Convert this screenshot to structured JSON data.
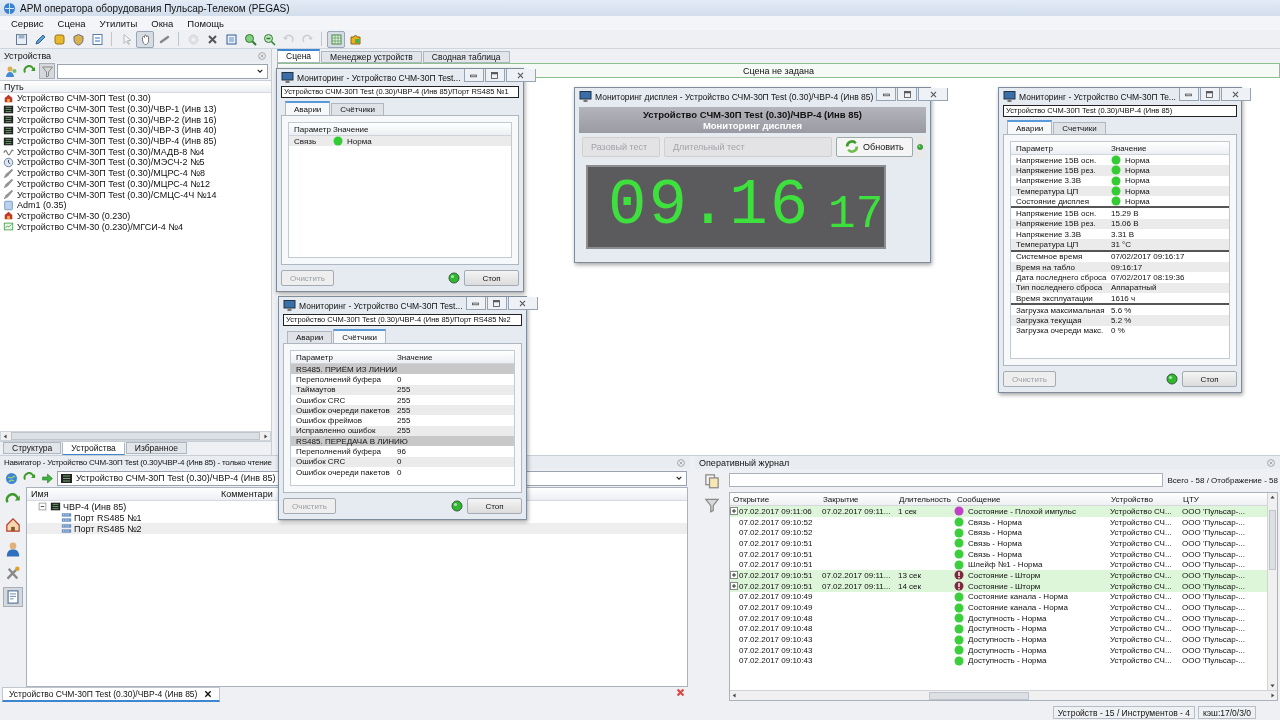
{
  "window": {
    "title": "АРМ оператора оборудования Пульсар-Телеком (PEGAS)"
  },
  "menu": [
    "Сервис",
    "Сцена",
    "Утилиты",
    "Окна",
    "Помощь"
  ],
  "toolbar": [
    {
      "pressed": false,
      "disabled": false
    },
    {
      "pressed": false,
      "disabled": false
    },
    {
      "pressed": false,
      "disabled": false
    },
    {
      "pressed": false,
      "disabled": false
    },
    {
      "pressed": false,
      "disabled": false
    },
    {
      "pressed": false,
      "disabled": true
    },
    {
      "pressed": true,
      "disabled": false
    },
    {
      "pressed": false,
      "disabled": false
    },
    {
      "pressed": false,
      "disabled": true
    },
    {
      "pressed": false,
      "disabled": false
    },
    {
      "pressed": false,
      "disabled": false
    },
    {
      "pressed": false,
      "disabled": false
    },
    {
      "pressed": false,
      "disabled": false
    },
    {
      "pressed": false,
      "disabled": true
    },
    {
      "pressed": false,
      "disabled": true
    },
    {
      "pressed": true,
      "disabled": false
    },
    {
      "pressed": false,
      "disabled": false
    }
  ],
  "devices_panel": {
    "title": "Устройства",
    "column": "Путь",
    "items": [
      {
        "label": "Устройство СЧМ-30П Test (0.30)",
        "kind": "alarm"
      },
      {
        "label": "Устройство СЧМ-30П Test (0.30)/ЧВР-1 (Инв 13)",
        "kind": "board"
      },
      {
        "label": "Устройство СЧМ-30П Test (0.30)/ЧВР-2 (Инв 16)",
        "kind": "board"
      },
      {
        "label": "Устройство СЧМ-30П Test (0.30)/ЧВР-3 (Инв 40)",
        "kind": "board"
      },
      {
        "label": "Устройство СЧМ-30П Test (0.30)/ЧВР-4 (Инв 85)",
        "kind": "board"
      },
      {
        "label": "Устройство СЧМ-30П Test (0.30)/МАДВ-8 №4",
        "kind": "wave"
      },
      {
        "label": "Устройство СЧМ-30П Test (0.30)/МЭСЧ-2 №5",
        "kind": "clock"
      },
      {
        "label": "Устройство СЧМ-30П Test (0.30)/МЦРС-4 №8",
        "kind": "pen"
      },
      {
        "label": "Устройство СЧМ-30П Test (0.30)/МЦРС-4 №12",
        "kind": "pen"
      },
      {
        "label": "Устройство СЧМ-30П Test (0.30)/СМЦС-4Ч №14",
        "kind": "pen"
      },
      {
        "label": "Adm1 (0.35)",
        "kind": "panel"
      },
      {
        "label": "Устройство СЧМ-30 (0.230)",
        "kind": "alarm"
      },
      {
        "label": "Устройство СЧМ-30 (0.230)/МГСИ-4 №4",
        "kind": "chart"
      }
    ],
    "tabs": [
      {
        "label": "Структура",
        "selected": false
      },
      {
        "label": "Устройства",
        "selected": true
      },
      {
        "label": "Избранное",
        "selected": false
      }
    ]
  },
  "scene_tabs": [
    {
      "label": "Сцена",
      "selected": true
    },
    {
      "label": "Менеджер устройств",
      "selected": false
    },
    {
      "label": "Сводная таблица",
      "selected": false
    }
  ],
  "scene_title": "Сцена не задана",
  "monitors": [
    {
      "title": "Мониторинг - Устройство СЧМ-30П Test...",
      "path": "Устройство СЧМ-30П Test (0.30)/ЧВР-4 (Инв 85)/Порт RS485 №1",
      "tabs": [
        {
          "label": "Аварии",
          "selected": true
        },
        {
          "label": "Счётчики",
          "selected": false
        }
      ],
      "columns": [
        "Параметр",
        "Значение"
      ],
      "groups": [
        [
          {
            "kind": "status",
            "name": "Связь",
            "value": "Норма",
            "color": "#33cc33"
          }
        ]
      ],
      "clear_button": {
        "label": "Очистить",
        "disabled": true
      },
      "running": true,
      "stop_button": "Стоп"
    },
    {
      "title": "Мониторинг - Устройство СЧМ-30П Test...",
      "path": "Устройство СЧМ-30П Test (0.30)/ЧВР-4 (Инв 85)/Порт RS485 №2",
      "tabs": [
        {
          "label": "Аварии",
          "selected": false
        },
        {
          "label": "Счётчики",
          "selected": true
        }
      ],
      "columns": [
        "Параметр",
        "Значение"
      ],
      "groups": [
        [
          {
            "kind": "section",
            "name": "RS485. ПРИЁМ ИЗ ЛИНИИ"
          },
          {
            "kind": "value",
            "name": "Переполнений буфера",
            "value": "0"
          },
          {
            "kind": "value",
            "name": "Таймаутов",
            "value": "255"
          },
          {
            "kind": "value",
            "name": "Ошибок CRC",
            "value": "255"
          },
          {
            "kind": "value",
            "name": "Ошибок очереди пакетов",
            "value": "255"
          },
          {
            "kind": "value",
            "name": "Ошибок фреймов",
            "value": "255"
          },
          {
            "kind": "value",
            "name": "Исправленно ошибок",
            "value": "255"
          },
          {
            "kind": "section",
            "name": "RS485. ПЕРЕДАЧА В ЛИНИЮ"
          },
          {
            "kind": "value",
            "name": "Переполнений буфера",
            "value": "96"
          },
          {
            "kind": "value",
            "name": "Ошибок CRC",
            "value": "0"
          },
          {
            "kind": "value",
            "name": "Ошибок очереди пакетов",
            "value": "0"
          }
        ]
      ],
      "clear_button": {
        "label": "Очистить",
        "disabled": true
      },
      "running": true,
      "stop_button": "Стоп"
    },
    {
      "title": "Мониторинг - Устройство СЧМ-30П Te...",
      "path": "Устройство СЧМ-30П Test (0.30)/ЧВР-4 (Инв 85)",
      "tabs": [
        {
          "label": "Аварии",
          "selected": true
        },
        {
          "label": "Счетчики",
          "selected": false
        }
      ],
      "columns": [
        "Параметр",
        "Значение"
      ],
      "groups": [
        [
          {
            "kind": "status",
            "name": "Напряжение 15В осн.",
            "value": "Норма",
            "color": "#33cc33"
          },
          {
            "kind": "status",
            "name": "Напряжение 15В рез.",
            "value": "Норма",
            "color": "#33cc33"
          },
          {
            "kind": "status",
            "name": "Напряжение 3.3В",
            "value": "Норма",
            "color": "#33cc33"
          },
          {
            "kind": "status",
            "name": "Температура ЦП",
            "value": "Норма",
            "color": "#33cc33"
          },
          {
            "kind": "status",
            "name": "Состояние дисплея",
            "value": "Норма",
            "color": "#33cc33"
          }
        ],
        [
          {
            "kind": "value",
            "name": "Напряжение 15В осн.",
            "value": "15.29 В"
          },
          {
            "kind": "value",
            "name": "Напряжение 15В рез.",
            "value": "15.06 В"
          },
          {
            "kind": "value",
            "name": "Напряжение 3.3В",
            "value": "3.31 В"
          },
          {
            "kind": "value",
            "name": "Температура ЦП",
            "value": "31 °C"
          }
        ],
        [
          {
            "kind": "value",
            "name": "Системное время",
            "value": "07/02/2017 09:16:17"
          },
          {
            "kind": "value",
            "name": "Время на табло",
            "value": "09:16:17"
          },
          {
            "kind": "value",
            "name": "Дата последнего сброса",
            "value": "07/02/2017 08:19:36"
          },
          {
            "kind": "value",
            "name": "Тип последнего сброса",
            "value": "Аппаратный"
          },
          {
            "kind": "value",
            "name": "Время эксплуатации",
            "value": "1616 ч"
          }
        ],
        [
          {
            "kind": "value",
            "name": "Загрузка максимальная",
            "value": "5.6 %"
          },
          {
            "kind": "value",
            "name": "Загрузка текущая",
            "value": "5.2 %"
          },
          {
            "kind": "value",
            "name": "Загрузка очереди макс.",
            "value": "0 %"
          }
        ]
      ],
      "clear_button": {
        "label": "Очистить",
        "disabled": true
      },
      "running": true,
      "stop_button": "Стоп"
    }
  ],
  "display_monitor": {
    "title": "Мониторинг дисплея - Устройство СЧМ-30П Test (0.30)/ЧВР-4 (Инв 85)",
    "device": "Устройство СЧМ-30П Test (0.30)/ЧВР-4 (Инв 85)",
    "subtitle": "Мониторинг дисплея",
    "buttons": [
      {
        "label": "Разовый тест",
        "disabled": true
      },
      {
        "label": "Длительный тест",
        "disabled": true
      },
      {
        "label": "Обновить",
        "disabled": false
      }
    ],
    "running": true,
    "time": "09.16",
    "seconds": "17"
  },
  "navigator": {
    "title": "Навигатор - Устройство СЧМ-30П Test (0.30)/ЧВР-4 (Инв 85) - только чтение",
    "address": "Устройство СЧМ-30П Test (0.30)/ЧВР-4 (Инв 85)",
    "columns": [
      "Имя",
      "Комментари"
    ],
    "tree": [
      {
        "label": "ЧВР-4 (Инв 85)",
        "expanded": true,
        "selected": false,
        "children": [
          {
            "label": "Порт RS485 №1",
            "selected": false
          },
          {
            "label": "Порт RS485 №2",
            "selected": true
          }
        ]
      }
    ],
    "document_tabs": [
      {
        "label": "Устройство СЧМ-30П Test (0.30)/ЧВР-4 (Инв 85)",
        "selected": true
      }
    ]
  },
  "journal": {
    "title": "Оперативный журнал",
    "count": "Всего - 58 / Отображение - 58",
    "columns": [
      "Открытие",
      "Закрытие",
      "Длительность",
      "Сообщение",
      "Устройство",
      "ЦТУ"
    ],
    "rows": [
      {
        "open": "07.02.2017 09:11:06",
        "close": "07.02.2017 09:11...",
        "duration": "1 сек",
        "kind": "impulse",
        "message": "Состояние - Плохой импульс",
        "device": "Устройство СЧ...",
        "ctu": "ООО 'Пульсар-...",
        "expandable": true,
        "highlighted": true
      },
      {
        "open": "07.02.2017 09:10:52",
        "kind": "ok",
        "message": "Связь - Норма",
        "device": "Устройство СЧ...",
        "ctu": "ООО 'Пульсар-...",
        "expandable": false,
        "highlighted": false
      },
      {
        "open": "07.02.2017 09:10:52",
        "kind": "ok",
        "message": "Связь - Норма",
        "device": "Устройство СЧ...",
        "ctu": "ООО 'Пульсар-...",
        "expandable": false,
        "highlighted": false
      },
      {
        "open": "07.02.2017 09:10:51",
        "kind": "ok",
        "message": "Связь - Норма",
        "device": "Устройство СЧ...",
        "ctu": "ООО 'Пульсар-...",
        "expandable": false,
        "highlighted": false
      },
      {
        "open": "07.02.2017 09:10:51",
        "kind": "ok",
        "message": "Связь - Норма",
        "device": "Устройство СЧ...",
        "ctu": "ООО 'Пульсар-...",
        "expandable": false,
        "highlighted": false
      },
      {
        "open": "07.02.2017 09:10:51",
        "kind": "ok",
        "message": "Шлейф №1 - Норма",
        "device": "Устройство СЧ...",
        "ctu": "ООО 'Пульсар-...",
        "expandable": false,
        "highlighted": false
      },
      {
        "open": "07.02.2017 09:10:51",
        "close": "07.02.2017 09:11...",
        "duration": "13 сек",
        "kind": "alarm",
        "message": "Состояние - Шторм",
        "device": "Устройство СЧ...",
        "ctu": "ООО 'Пульсар-...",
        "expandable": true,
        "highlighted": true
      },
      {
        "open": "07.02.2017 09:10:51",
        "close": "07.02.2017 09:11...",
        "duration": "14 сек",
        "kind": "alarm",
        "message": "Состояние - Шторм",
        "device": "Устройство СЧ...",
        "ctu": "ООО 'Пульсар-...",
        "expandable": true,
        "highlighted": true
      },
      {
        "open": "07.02.2017 09:10:49",
        "kind": "ok",
        "message": "Состояние канала - Норма",
        "device": "Устройство СЧ...",
        "ctu": "ООО 'Пульсар-...",
        "expandable": false,
        "highlighted": false
      },
      {
        "open": "07.02.2017 09:10:49",
        "kind": "ok",
        "message": "Состояние канала - Норма",
        "device": "Устройство СЧ...",
        "ctu": "ООО 'Пульсар-...",
        "expandable": false,
        "highlighted": false
      },
      {
        "open": "07.02.2017 09:10:48",
        "kind": "ok",
        "message": "Доступность - Норма",
        "device": "Устройство СЧ...",
        "ctu": "ООО 'Пульсар-...",
        "expandable": false,
        "highlighted": false
      },
      {
        "open": "07.02.2017 09:10:48",
        "kind": "ok",
        "message": "Доступность - Норма",
        "device": "Устройство СЧ...",
        "ctu": "ООО 'Пульсар-...",
        "expandable": false,
        "highlighted": false
      },
      {
        "open": "07.02.2017 09:10:43",
        "kind": "ok",
        "message": "Доступность - Норма",
        "device": "Устройство СЧ...",
        "ctu": "ООО 'Пульсар-...",
        "expandable": false,
        "highlighted": false
      },
      {
        "open": "07.02.2017 09:10:43",
        "kind": "ok",
        "message": "Доступность - Норма",
        "device": "Устройство СЧ...",
        "ctu": "ООО 'Пульсар-...",
        "expandable": false,
        "highlighted": false
      },
      {
        "open": "07.02.2017 09:10:43",
        "kind": "ok",
        "message": "Доступность - Норма",
        "device": "Устройство СЧ...",
        "ctu": "ООО 'Пульсар-...",
        "expandable": false,
        "highlighted": false
      }
    ]
  },
  "status_bar": [
    "Устройств - 15 / Инструментов - 4",
    "кэш:17/0/3/0"
  ]
}
